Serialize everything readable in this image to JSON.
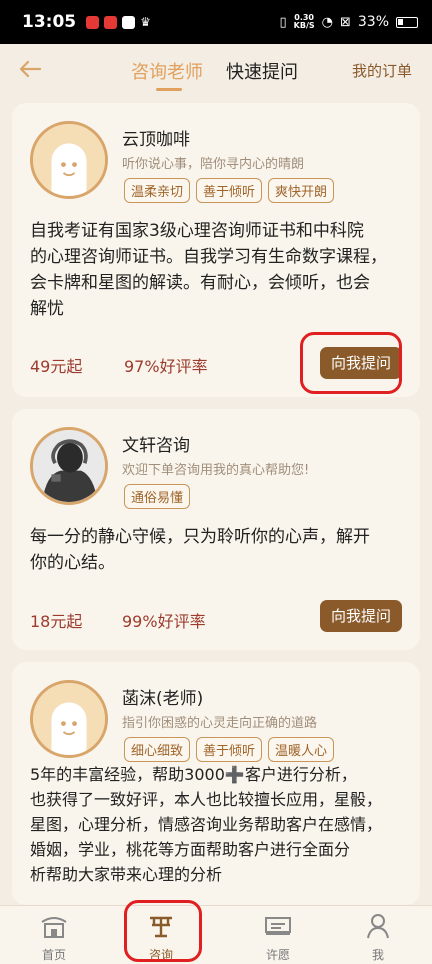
{
  "status_bar": {
    "time": "13:05",
    "speed_top": "0.30",
    "speed_bottom": "KB/S",
    "battery": "33%"
  },
  "header": {
    "tabs": [
      {
        "label": "咨询老师",
        "active": true
      },
      {
        "label": "快速提问",
        "active": false
      }
    ],
    "my_orders": "我的订单"
  },
  "cards": [
    {
      "name": "云顶咖啡",
      "tagline": "听你说心事，陪你寻内心的晴朗",
      "tags": [
        "温柔亲切",
        "善于倾听",
        "爽快开朗"
      ],
      "desc_lines": [
        "自我考证有国家3级心理咨询师证书和中科院",
        "的心理咨询师证书。自我学习有生命数字课程，",
        "会卡牌和星图的解读。有耐心，会倾听，也会",
        "解忧"
      ],
      "price": "49元起",
      "rating": "97%好评率",
      "ask_label": "向我提问"
    },
    {
      "name": "文轩咨询",
      "tagline": "欢迎下单咨询用我的真心帮助您!",
      "tags": [
        "通俗易懂"
      ],
      "desc_lines": [
        "每一分的静心守候，只为聆听你的心声，解开",
        "你的心结。"
      ],
      "price": "18元起",
      "rating": "99%好评率",
      "ask_label": "向我提问"
    },
    {
      "name": "菡沫(老师)",
      "tagline": "指引你困惑的心灵走向正确的道路",
      "tags": [
        "细心细致",
        "善于倾听",
        "温暖人心"
      ],
      "desc_lines": [
        "5年的丰富经验，帮助3000➕客户进行分析，",
        "也获得了一致好评，本人也比较擅长应用，星骰，",
        "星图，心理分析，情感咨询业务帮助客户在感情，",
        "婚姻，学业，桃花等方面帮助客户进行全面分",
        "析帮助大家带来心理的分析"
      ]
    }
  ],
  "bottom_nav": [
    {
      "label": "首页",
      "icon": "home-icon"
    },
    {
      "label": "咨询",
      "icon": "consult-icon",
      "active": true
    },
    {
      "label": "许愿",
      "icon": "wish-icon"
    },
    {
      "label": "我",
      "icon": "profile-icon"
    }
  ],
  "colors": {
    "accent": "#e0a15e",
    "button": "#8b5a2b",
    "price": "#9c3b2e",
    "highlight": "#e02020",
    "background": "#f4ede3"
  }
}
